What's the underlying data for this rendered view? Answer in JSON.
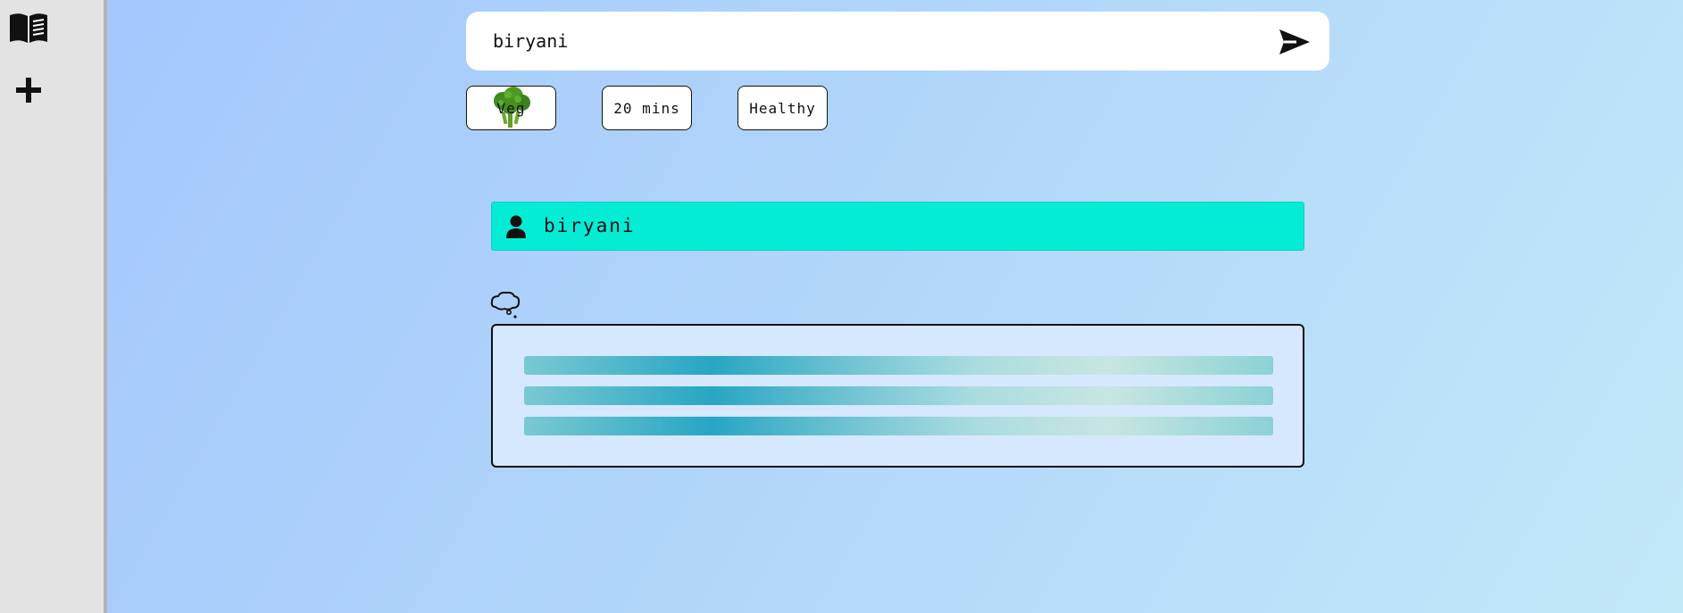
{
  "sidebar": {
    "items": [
      {
        "icon": "recipe-book-icon"
      },
      {
        "icon": "plus-icon"
      }
    ]
  },
  "search": {
    "value": "biryani",
    "placeholder": "",
    "send_icon": "send-icon"
  },
  "filters": [
    {
      "label": "Veg",
      "icon": "broccoli-icon"
    },
    {
      "label": "20 mins"
    },
    {
      "label": "Healthy"
    }
  ],
  "chat": {
    "user_message": "biryani",
    "user_icon": "user-icon",
    "response_icon": "thought-bubble-icon",
    "response_loading": true,
    "skeleton_lines": 3
  },
  "colors": {
    "user_bubble": "#05ecd5",
    "response_bg": "#d6e8fd",
    "sidebar_bg": "#e3e3e3"
  }
}
